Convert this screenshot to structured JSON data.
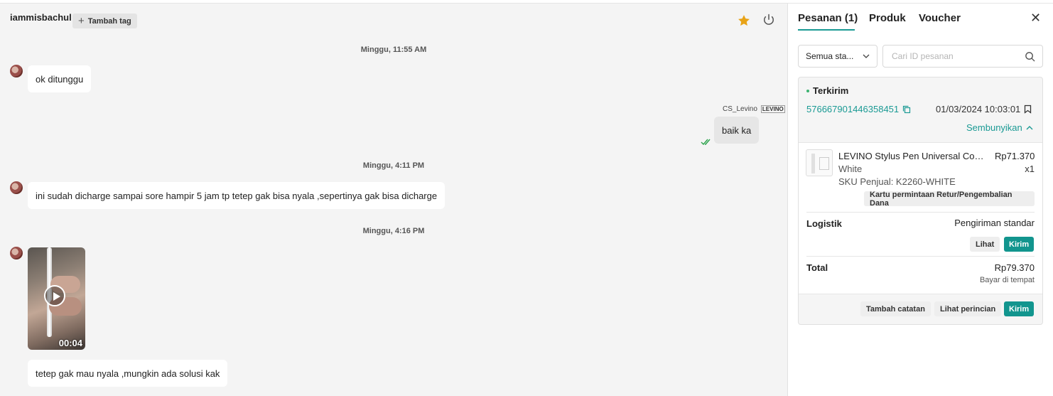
{
  "chat": {
    "username": "iammisbachul",
    "add_tag_label": "Tambah tag",
    "messages": [
      {
        "type": "timestamp",
        "text": "Minggu, 11:55 AM"
      },
      {
        "type": "incoming",
        "text": "ok ditunggu"
      },
      {
        "type": "outgoing",
        "agent": "CS_Levino",
        "agent_logo": "LEVINO",
        "text": "baik ka",
        "status": "read"
      },
      {
        "type": "timestamp",
        "text": "Minggu, 4:11 PM"
      },
      {
        "type": "incoming",
        "text": "ini sudah dicharge sampai sore hampir 5 jam tp tetep gak bisa nyala ,sepertinya gak bisa dicharge"
      },
      {
        "type": "timestamp",
        "text": "Minggu, 4:16 PM"
      },
      {
        "type": "video",
        "duration": "00:04"
      },
      {
        "type": "incoming",
        "text": "tetep gak mau nyala ,mungkin ada solusi kak"
      }
    ]
  },
  "panel": {
    "tabs": [
      "Pesanan (1)",
      "Produk",
      "Voucher"
    ],
    "active_tab": 0,
    "status_filter": "Semua sta...",
    "search_placeholder": "Cari ID pesanan",
    "order": {
      "status": "Terkirim",
      "order_id": "576667901446358451",
      "date": "01/03/2024 10:03:01",
      "toggle_label": "Sembunyikan",
      "product": {
        "name": "LEVINO Stylus Pen Universal Comp...",
        "price": "Rp71.370",
        "variant": "White",
        "qty": "x1",
        "sku": "SKU Penjual: K2260-WHITE",
        "return_button": "Kartu permintaan Retur/Pengembalian Dana"
      },
      "logistics": {
        "label": "Logistik",
        "value": "Pengiriman standar",
        "view_button": "Lihat",
        "send_button": "Kirim"
      },
      "total": {
        "label": "Total",
        "value": "Rp79.370",
        "payment": "Bayar di tempat"
      },
      "footer": {
        "note_button": "Tambah catatan",
        "details_button": "Lihat perincian",
        "send_button": "Kirim"
      }
    }
  },
  "colors": {
    "accent": "#12958e",
    "star": "#e8a317",
    "status_dot": "#3cb371"
  }
}
